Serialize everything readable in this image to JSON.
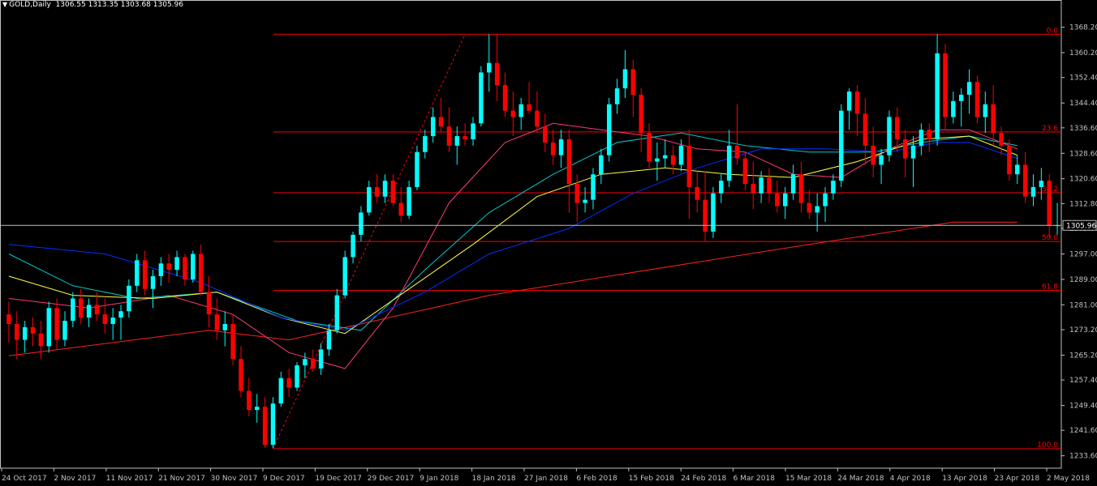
{
  "header": {
    "symbol_timeframe": "GOLD,Daily",
    "ohlc": "1306.55 1313.35 1303.68 1305.96"
  },
  "colors": {
    "background": "#000000",
    "bull": "#00ffff",
    "bear": "#ff0000",
    "axis": "#c0c0c0",
    "fib": "#ff0000",
    "ma_200": "#ff2020",
    "ma_20": "#ff3c78",
    "ma_50": "#0030ff",
    "ma_30": "#00c8c8",
    "ma_40": "#ffff40",
    "price_line": "#c0c0c0"
  },
  "chart_data": {
    "type": "candlestick",
    "symbol": "GOLD",
    "timeframe": "Daily",
    "last_price": "1305.96",
    "ylim": [
      1229.7,
      1373.7
    ],
    "y_ticks": [
      "1368.20",
      "1360.20",
      "1352.40",
      "1344.40",
      "1336.60",
      "1328.60",
      "1320.60",
      "1312.80",
      "1305.00",
      "1297.00",
      "1289.00",
      "1281.00",
      "1273.20",
      "1265.20",
      "1257.40",
      "1249.40",
      "1241.60",
      "1233.60"
    ],
    "x_labels": [
      "24 Oct 2017",
      "2 Nov 2017",
      "11 Nov 2017",
      "21 Nov 2017",
      "30 Nov 2017",
      "9 Dec 2017",
      "19 Dec 2017",
      "29 Dec 2017",
      "9 Jan 2018",
      "18 Jan 2018",
      "27 Jan 2018",
      "6 Feb 2018",
      "15 Feb 2018",
      "24 Feb 2018",
      "6 Mar 2018",
      "15 Mar 2018",
      "24 Mar 2018",
      "4 Apr 2018",
      "13 Apr 2018",
      "23 Apr 2018",
      "2 May 2018"
    ],
    "fib_levels": [
      {
        "label": "0.0",
        "price": 1366.0
      },
      {
        "label": "23.6",
        "price": 1335.3
      },
      {
        "label": "38.2",
        "price": 1316.2
      },
      {
        "label": "50.0",
        "price": 1300.9
      },
      {
        "label": "61.8",
        "price": 1285.5
      },
      {
        "label": "100.0",
        "price": 1235.8
      }
    ],
    "ohlc": [
      [
        1278,
        1282,
        1269,
        1275
      ],
      [
        1275,
        1279,
        1264,
        1270
      ],
      [
        1270,
        1276,
        1266,
        1274
      ],
      [
        1274,
        1277,
        1268,
        1272
      ],
      [
        1272,
        1276,
        1264,
        1268
      ],
      [
        1268,
        1282,
        1266,
        1280
      ],
      [
        1280,
        1283,
        1267,
        1270
      ],
      [
        1270,
        1279,
        1268,
        1276
      ],
      [
        1276,
        1285,
        1274,
        1283
      ],
      [
        1283,
        1286,
        1275,
        1277
      ],
      [
        1277,
        1283,
        1274,
        1281
      ],
      [
        1281,
        1285,
        1276,
        1278
      ],
      [
        1278,
        1283,
        1272,
        1275
      ],
      [
        1275,
        1280,
        1270,
        1277
      ],
      [
        1277,
        1281,
        1270,
        1279
      ],
      [
        1279,
        1289,
        1277,
        1287
      ],
      [
        1287,
        1297,
        1285,
        1295
      ],
      [
        1295,
        1298,
        1284,
        1286
      ],
      [
        1286,
        1292,
        1280,
        1290
      ],
      [
        1290,
        1296,
        1287,
        1294
      ],
      [
        1294,
        1297,
        1288,
        1292
      ],
      [
        1292,
        1298,
        1290,
        1296
      ],
      [
        1296,
        1297,
        1287,
        1289
      ],
      [
        1289,
        1298,
        1288,
        1297
      ],
      [
        1297,
        1300,
        1284,
        1285
      ],
      [
        1285,
        1290,
        1274,
        1278
      ],
      [
        1278,
        1283,
        1270,
        1273
      ],
      [
        1273,
        1279,
        1268,
        1275
      ],
      [
        1275,
        1278,
        1262,
        1264
      ],
      [
        1264,
        1268,
        1252,
        1254
      ],
      [
        1254,
        1258,
        1246,
        1248
      ],
      [
        1248,
        1253,
        1244,
        1249
      ],
      [
        1249,
        1252,
        1236,
        1237
      ],
      [
        1237,
        1252,
        1236,
        1250
      ],
      [
        1250,
        1260,
        1249,
        1258
      ],
      [
        1258,
        1261,
        1252,
        1255
      ],
      [
        1255,
        1263,
        1254,
        1262
      ],
      [
        1262,
        1266,
        1258,
        1264
      ],
      [
        1264,
        1267,
        1260,
        1261
      ],
      [
        1261,
        1269,
        1259,
        1267
      ],
      [
        1267,
        1275,
        1265,
        1273
      ],
      [
        1273,
        1286,
        1272,
        1284
      ],
      [
        1284,
        1298,
        1283,
        1296
      ],
      [
        1296,
        1304,
        1294,
        1303
      ],
      [
        1303,
        1312,
        1301,
        1310
      ],
      [
        1310,
        1320,
        1309,
        1318
      ],
      [
        1318,
        1322,
        1313,
        1315
      ],
      [
        1315,
        1322,
        1313,
        1320
      ],
      [
        1320,
        1322,
        1312,
        1313
      ],
      [
        1313,
        1318,
        1307,
        1309
      ],
      [
        1309,
        1320,
        1308,
        1318
      ],
      [
        1318,
        1331,
        1317,
        1329
      ],
      [
        1329,
        1336,
        1327,
        1334
      ],
      [
        1334,
        1343,
        1332,
        1340
      ],
      [
        1340,
        1346,
        1335,
        1337
      ],
      [
        1337,
        1343,
        1329,
        1331
      ],
      [
        1331,
        1337,
        1325,
        1334
      ],
      [
        1334,
        1338,
        1331,
        1333
      ],
      [
        1333,
        1340,
        1331,
        1338
      ],
      [
        1338,
        1356,
        1337,
        1354
      ],
      [
        1354,
        1366,
        1348,
        1357
      ],
      [
        1357,
        1366,
        1345,
        1350
      ],
      [
        1350,
        1354,
        1340,
        1342
      ],
      [
        1342,
        1348,
        1334,
        1340
      ],
      [
        1340,
        1346,
        1336,
        1344
      ],
      [
        1344,
        1351,
        1341,
        1342
      ],
      [
        1342,
        1348,
        1335,
        1337
      ],
      [
        1337,
        1341,
        1329,
        1332
      ],
      [
        1332,
        1336,
        1325,
        1328
      ],
      [
        1328,
        1336,
        1324,
        1333
      ],
      [
        1333,
        1336,
        1310,
        1319
      ],
      [
        1319,
        1322,
        1307,
        1313
      ],
      [
        1313,
        1318,
        1310,
        1314
      ],
      [
        1314,
        1324,
        1311,
        1322
      ],
      [
        1322,
        1330,
        1319,
        1328
      ],
      [
        1328,
        1346,
        1326,
        1344
      ],
      [
        1344,
        1352,
        1341,
        1349
      ],
      [
        1349,
        1361,
        1346,
        1355
      ],
      [
        1355,
        1358,
        1340,
        1347
      ],
      [
        1347,
        1349,
        1329,
        1335
      ],
      [
        1335,
        1338,
        1324,
        1326
      ],
      [
        1326,
        1332,
        1320,
        1327
      ],
      [
        1327,
        1333,
        1324,
        1328
      ],
      [
        1328,
        1331,
        1322,
        1325
      ],
      [
        1325,
        1333,
        1323,
        1331
      ],
      [
        1331,
        1336,
        1308,
        1318
      ],
      [
        1318,
        1323,
        1310,
        1314
      ],
      [
        1314,
        1323,
        1301,
        1304
      ],
      [
        1304,
        1318,
        1302,
        1316
      ],
      [
        1316,
        1322,
        1313,
        1320
      ],
      [
        1320,
        1336,
        1318,
        1331
      ],
      [
        1331,
        1344,
        1325,
        1327
      ],
      [
        1327,
        1329,
        1317,
        1319
      ],
      [
        1319,
        1326,
        1311,
        1316
      ],
      [
        1316,
        1323,
        1313,
        1321
      ],
      [
        1321,
        1324,
        1313,
        1316
      ],
      [
        1316,
        1320,
        1310,
        1312
      ],
      [
        1312,
        1318,
        1308,
        1316
      ],
      [
        1316,
        1325,
        1314,
        1322
      ],
      [
        1322,
        1326,
        1310,
        1313
      ],
      [
        1313,
        1317,
        1308,
        1310
      ],
      [
        1310,
        1316,
        1304,
        1312
      ],
      [
        1312,
        1318,
        1307,
        1316
      ],
      [
        1316,
        1322,
        1314,
        1320
      ],
      [
        1320,
        1344,
        1318,
        1342
      ],
      [
        1342,
        1349,
        1336,
        1348
      ],
      [
        1348,
        1350,
        1334,
        1341
      ],
      [
        1341,
        1346,
        1325,
        1331
      ],
      [
        1331,
        1337,
        1321,
        1325
      ],
      [
        1325,
        1330,
        1319,
        1328
      ],
      [
        1328,
        1342,
        1326,
        1340
      ],
      [
        1340,
        1343,
        1329,
        1333
      ],
      [
        1333,
        1336,
        1321,
        1327
      ],
      [
        1327,
        1334,
        1318,
        1331
      ],
      [
        1331,
        1338,
        1328,
        1336
      ],
      [
        1336,
        1338,
        1329,
        1333
      ],
      [
        1333,
        1366,
        1331,
        1360
      ],
      [
        1360,
        1363,
        1336,
        1340
      ],
      [
        1340,
        1348,
        1338,
        1345
      ],
      [
        1345,
        1349,
        1337,
        1347
      ],
      [
        1347,
        1355,
        1341,
        1351
      ],
      [
        1351,
        1353,
        1338,
        1340
      ],
      [
        1340,
        1348,
        1335,
        1344
      ],
      [
        1344,
        1350,
        1331,
        1335
      ],
      [
        1335,
        1337,
        1328,
        1331
      ],
      [
        1331,
        1333,
        1320,
        1322
      ],
      [
        1322,
        1328,
        1319,
        1325
      ],
      [
        1325,
        1329,
        1313,
        1315
      ],
      [
        1315,
        1322,
        1312,
        1318
      ],
      [
        1318,
        1324,
        1314,
        1320
      ],
      [
        1320,
        1322,
        1302,
        1306
      ],
      [
        1306,
        1313,
        1303,
        1306
      ]
    ],
    "moving_averages": [
      {
        "name": "MA 200",
        "key": "ma_200",
        "points": [
          [
            0,
            1265
          ],
          [
            25,
            1273
          ],
          [
            35,
            1270
          ],
          [
            60,
            1284
          ],
          [
            95,
            1298
          ],
          [
            118,
            1307
          ],
          [
            126,
            1307
          ]
        ]
      },
      {
        "name": "MA 20",
        "key": "ma_20",
        "points": [
          [
            0,
            1283
          ],
          [
            10,
            1280
          ],
          [
            20,
            1284
          ],
          [
            28,
            1278
          ],
          [
            35,
            1266
          ],
          [
            42,
            1261
          ],
          [
            48,
            1280
          ],
          [
            55,
            1313
          ],
          [
            62,
            1332
          ],
          [
            68,
            1338
          ],
          [
            74,
            1336
          ],
          [
            80,
            1334
          ],
          [
            86,
            1330
          ],
          [
            92,
            1329
          ],
          [
            98,
            1322
          ],
          [
            104,
            1321
          ],
          [
            110,
            1330
          ],
          [
            116,
            1336
          ],
          [
            120,
            1336
          ],
          [
            126,
            1330
          ]
        ]
      },
      {
        "name": "MA 30",
        "key": "ma_30",
        "points": [
          [
            0,
            1297
          ],
          [
            8,
            1287
          ],
          [
            16,
            1283
          ],
          [
            26,
            1285
          ],
          [
            36,
            1276
          ],
          [
            44,
            1273
          ],
          [
            52,
            1292
          ],
          [
            60,
            1310
          ],
          [
            68,
            1322
          ],
          [
            76,
            1332
          ],
          [
            84,
            1335
          ],
          [
            92,
            1331
          ],
          [
            100,
            1329
          ],
          [
            108,
            1329
          ],
          [
            114,
            1332
          ],
          [
            120,
            1334
          ],
          [
            126,
            1331
          ]
        ]
      },
      {
        "name": "MA 40",
        "key": "ma_40",
        "points": [
          [
            0,
            1290
          ],
          [
            8,
            1284
          ],
          [
            18,
            1283
          ],
          [
            26,
            1285
          ],
          [
            34,
            1277
          ],
          [
            42,
            1272
          ],
          [
            50,
            1286
          ],
          [
            58,
            1300
          ],
          [
            66,
            1315
          ],
          [
            74,
            1322
          ],
          [
            82,
            1324
          ],
          [
            90,
            1322
          ],
          [
            98,
            1321
          ],
          [
            106,
            1326
          ],
          [
            114,
            1333
          ],
          [
            120,
            1334
          ],
          [
            126,
            1328
          ]
        ]
      },
      {
        "name": "MA 50",
        "key": "ma_50",
        "points": [
          [
            0,
            1300
          ],
          [
            12,
            1297
          ],
          [
            24,
            1288
          ],
          [
            34,
            1277
          ],
          [
            42,
            1273
          ],
          [
            52,
            1285
          ],
          [
            60,
            1297
          ],
          [
            70,
            1305
          ],
          [
            78,
            1316
          ],
          [
            86,
            1324
          ],
          [
            94,
            1330
          ],
          [
            102,
            1330
          ],
          [
            110,
            1329
          ],
          [
            116,
            1332
          ],
          [
            120,
            1332
          ],
          [
            126,
            1327
          ]
        ]
      }
    ],
    "trend_line": {
      "style": "dashed",
      "from": [
        33,
        1235.8
      ],
      "to": [
        57,
        1366
      ]
    }
  }
}
